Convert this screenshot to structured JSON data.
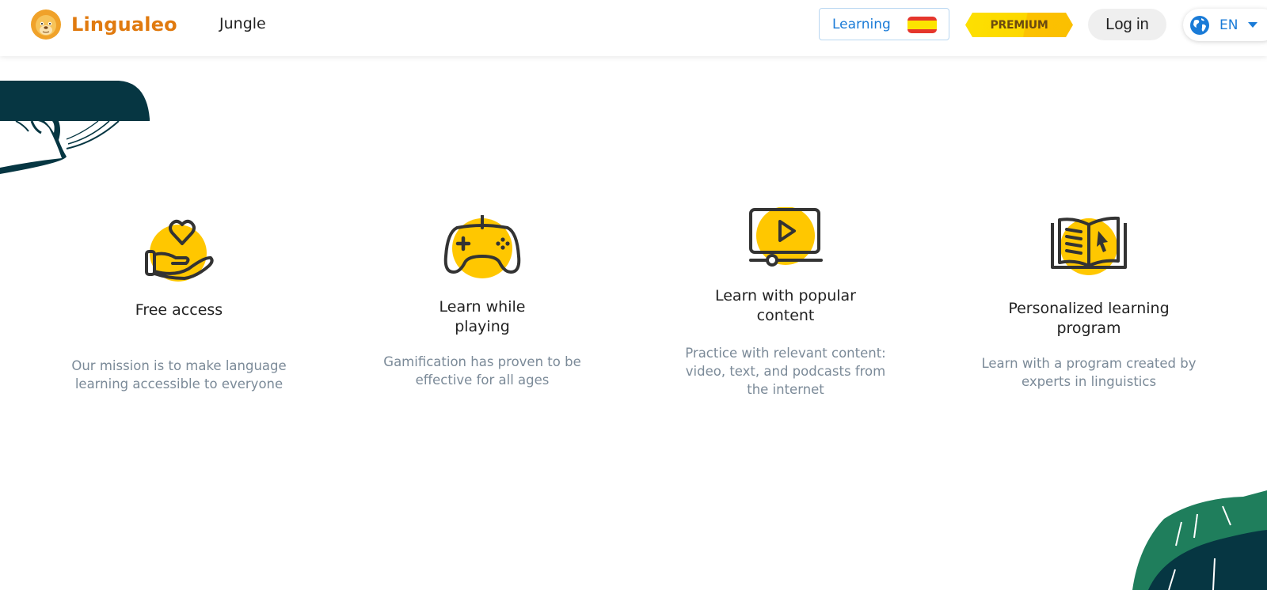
{
  "header": {
    "brand": "Lingualeo",
    "nav_link": "Jungle",
    "learning_label": "Learning",
    "learning_flag": "spain-flag",
    "premium_label": "PREMIUM",
    "login_label": "Log in",
    "language_code": "EN"
  },
  "colors": {
    "brand_orange": "#e07a0f",
    "link_blue": "#1a7bd7",
    "accent_yellow": "#ffc700",
    "icon_stroke": "#333333",
    "deco_dark_teal": "#063642",
    "deco_green": "#1f7e5c"
  },
  "features": [
    {
      "icon": "hand-heart-icon",
      "title": "Free access",
      "description": "Our mission is to make language learning accessible to everyone"
    },
    {
      "icon": "gamepad-icon",
      "title": "Learn while playing",
      "description": "Gamification has proven to be effective for all ages"
    },
    {
      "icon": "video-player-icon",
      "title": "Learn with popular content",
      "description": "Practice with relevant content: video, text, and podcasts from the internet"
    },
    {
      "icon": "book-cursor-icon",
      "title": "Personalized learning program",
      "description": "Learn with a program created by experts in linguistics"
    }
  ]
}
